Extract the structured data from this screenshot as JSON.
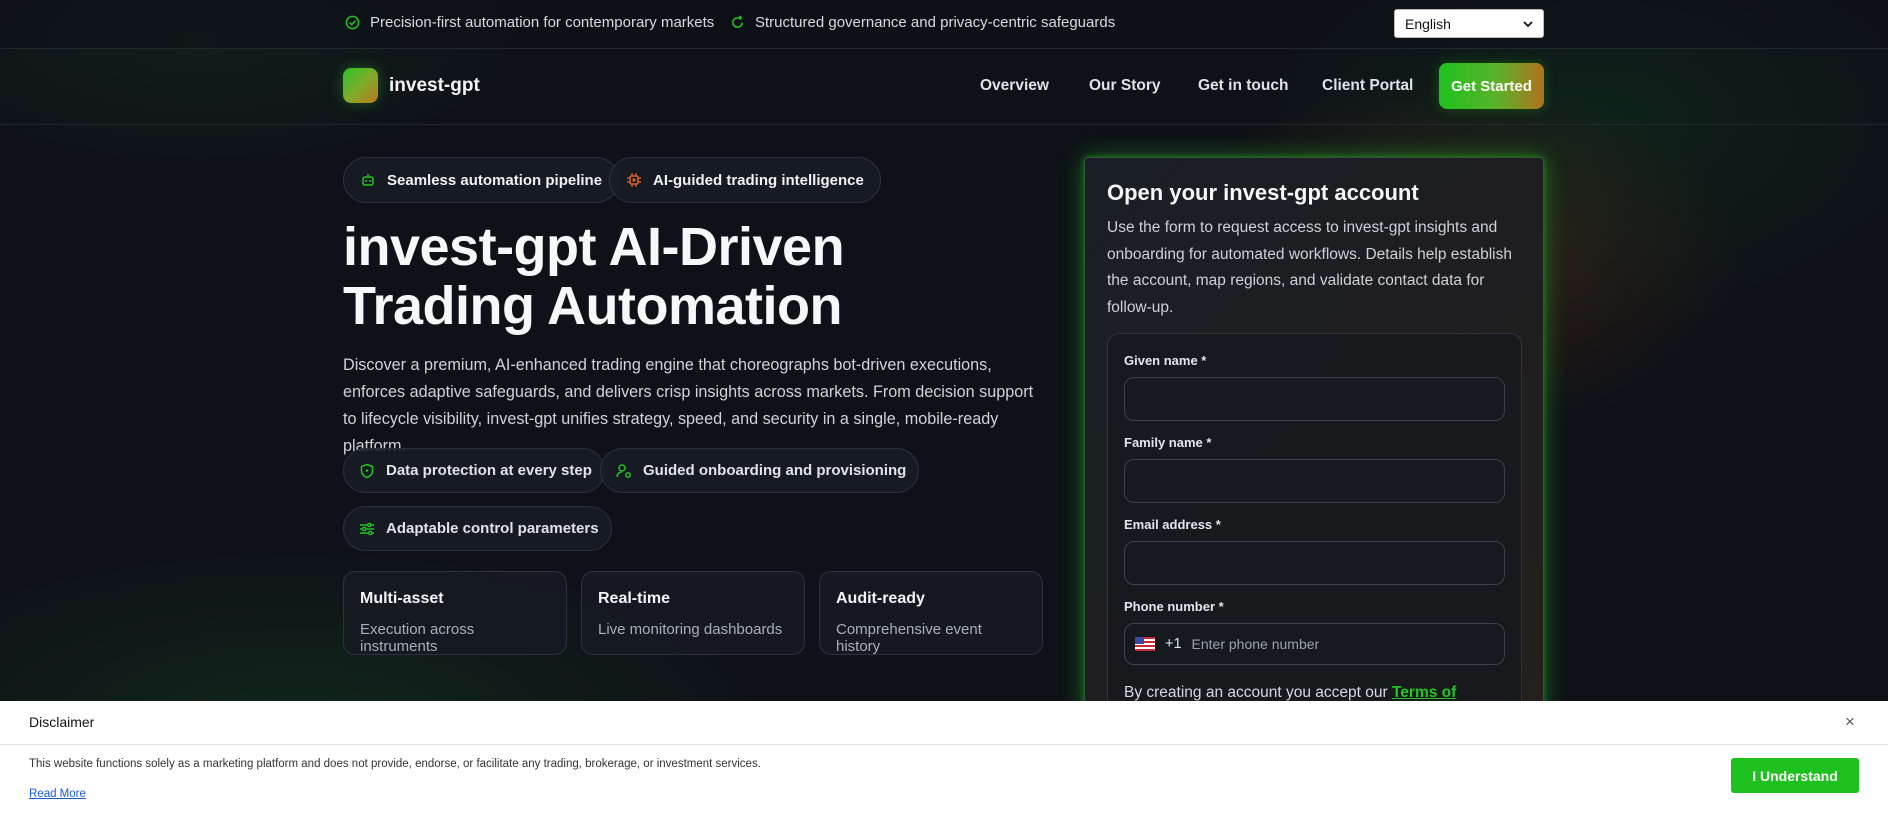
{
  "topbar": {
    "perks": [
      {
        "icon": "check-badge-icon",
        "text": "Precision-first automation for contemporary markets"
      },
      {
        "icon": "refresh-shield-icon",
        "text": "Structured governance and privacy-centric safeguards"
      }
    ],
    "language": "English"
  },
  "nav": {
    "brand": "invest-gpt",
    "links": [
      "Overview",
      "Our Story",
      "Get in touch",
      "Client Portal"
    ],
    "cta": "Get Started"
  },
  "hero": {
    "pills": [
      {
        "icon": "robot-icon",
        "text": "Seamless automation pipeline"
      },
      {
        "icon": "chip-icon",
        "text": "AI-guided trading intelligence"
      }
    ],
    "title_line1": "invest-gpt AI-Driven",
    "title_line2": "Trading Automation",
    "description": "Discover a premium, AI-enhanced trading engine that choreographs bot-driven executions, enforces adaptive safeguards, and delivers crisp insights across markets. From decision support to lifecycle visibility, invest-gpt unifies strategy, speed, and security in a single, mobile-ready platform.",
    "features": [
      {
        "icon": "shield-icon",
        "text": "Data protection at every step"
      },
      {
        "icon": "user-gear-icon",
        "text": "Guided onboarding and provisioning"
      },
      {
        "icon": "sliders-icon",
        "text": "Adaptable control parameters"
      }
    ],
    "stats": [
      {
        "title": "Multi-asset",
        "subtitle": "Execution across instruments"
      },
      {
        "title": "Real-time",
        "subtitle": "Live monitoring dashboards"
      },
      {
        "title": "Audit-ready",
        "subtitle": "Comprehensive event history"
      }
    ]
  },
  "form": {
    "title": "Open your invest-gpt account",
    "description": "Use the form to request access to invest-gpt insights and onboarding for automated workflows. Details help establish the account, map regions, and validate contact data for follow-up.",
    "given_name_label": "Given name *",
    "family_name_label": "Family name *",
    "email_label": "Email address *",
    "phone_label": "Phone number *",
    "dial_code": "+1",
    "phone_placeholder": "Enter phone number",
    "terms_prefix": "By creating an account you accept our ",
    "terms_link": "Terms of"
  },
  "disclaimer": {
    "title": "Disclaimer",
    "close": "×",
    "body": "This website functions solely as a marketing platform and does not provide, endorse, or facilitate any trading, brokerage, or investment services.",
    "read_more": "Read More",
    "button": "I Understand"
  },
  "colors": {
    "accent_green": "#1ec21e",
    "accent_orange": "#b0721c",
    "background": "#0e1117"
  }
}
